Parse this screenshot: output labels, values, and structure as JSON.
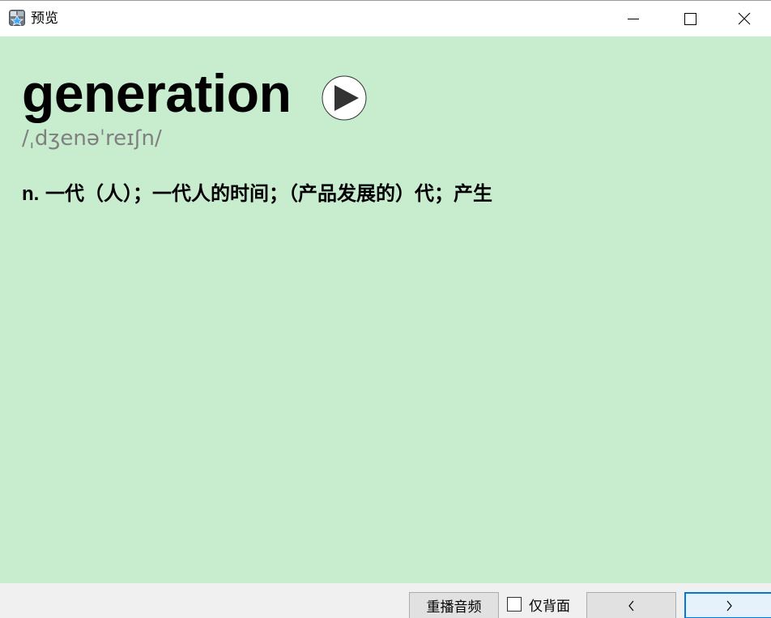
{
  "window": {
    "title": "预览",
    "icon": "anki-star-icon",
    "controls": [
      "minimize-icon",
      "maximize-icon",
      "close-icon"
    ]
  },
  "card": {
    "word": "generation",
    "phonetic": "/ˌdʒenəˈreɪʃn/",
    "part_of_speech": "n.",
    "meaning": "一代（人）；一代人的时间；（产品发展的）代；产生",
    "play_icon": "play-audio-icon",
    "background_color": "#c8ecce",
    "phonetic_color": "#808080"
  },
  "bottom_bar": {
    "replay_label": "重播音频",
    "back_only_label": "仅背面",
    "back_only_checked": false,
    "prev_label": "<",
    "next_label": ">"
  }
}
